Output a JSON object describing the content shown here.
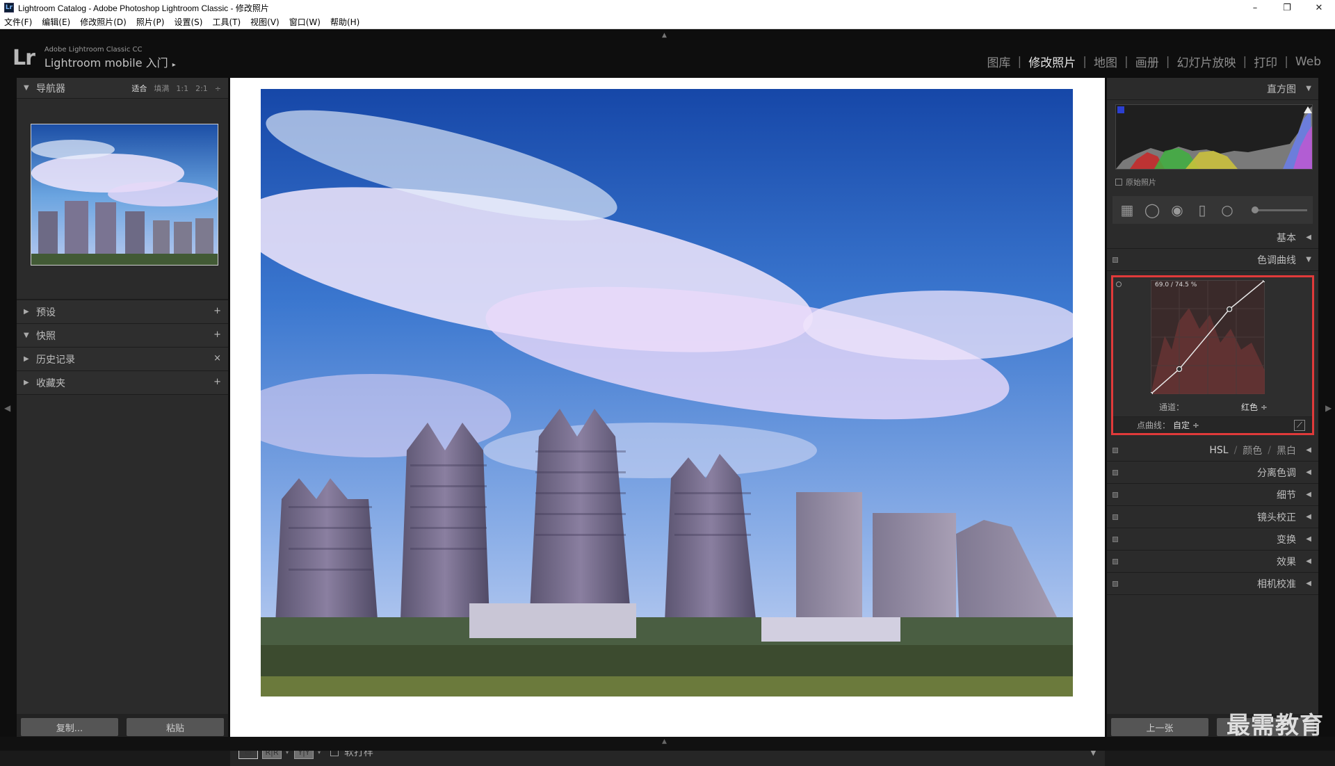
{
  "window": {
    "icon_text": "Lr",
    "title": "Lightroom Catalog - Adobe Photoshop Lightroom Classic - 修改照片",
    "minimize": "–",
    "maximize": "❐",
    "close": "✕"
  },
  "menu": [
    "文件(F)",
    "编辑(E)",
    "修改照片(D)",
    "照片(P)",
    "设置(S)",
    "工具(T)",
    "视图(V)",
    "窗口(W)",
    "帮助(H)"
  ],
  "identity": {
    "logo": "Lr",
    "product": "Adobe Lightroom Classic CC",
    "mobile": "Lightroom mobile 入门",
    "mobile_arrow": "▸"
  },
  "modules": [
    {
      "label": "图库",
      "active": false
    },
    {
      "label": "修改照片",
      "active": true
    },
    {
      "label": "地图",
      "active": false
    },
    {
      "label": "画册",
      "active": false
    },
    {
      "label": "幻灯片放映",
      "active": false
    },
    {
      "label": "打印",
      "active": false
    },
    {
      "label": "Web",
      "active": false
    }
  ],
  "left_panel": {
    "navigator": {
      "title": "导航器",
      "zoom_fit": "适合",
      "zoom_fill": "填满",
      "zoom_1_1": "1:1",
      "zoom_2_1": "2:1",
      "zoom_more": "÷"
    },
    "sections": [
      {
        "name": "presets",
        "title": "预设",
        "tri": "▶",
        "action": "+"
      },
      {
        "name": "snapshots",
        "title": "快照",
        "tri": "▼",
        "action": "+"
      },
      {
        "name": "history",
        "title": "历史记录",
        "tri": "▶",
        "action": "×"
      },
      {
        "name": "collections",
        "title": "收藏夹",
        "tri": "▶",
        "action": "+"
      }
    ],
    "copy_button": "复制...",
    "paste_button": "粘贴"
  },
  "toolbar": {
    "view_ry": "R|R",
    "view_yy": "Y|Y",
    "soft_proof": "软打样"
  },
  "right_panel": {
    "histogram": {
      "title": "直方图",
      "original_photo": "原始照片"
    },
    "basic": "基本",
    "tone_curve": {
      "title": "色调曲线",
      "readout": "69.0 / 74.5 %",
      "channel_label": "通道：",
      "channel_value": "红色 ÷",
      "point_curve_label": "点曲线：",
      "point_curve_value": "自定 ÷",
      "curve_points": [
        [
          0,
          0
        ],
        [
          25,
          22
        ],
        [
          69,
          74.5
        ],
        [
          100,
          100
        ]
      ]
    },
    "hsl": {
      "hsl": "HSL",
      "color": "颜色",
      "bw": "黑白",
      "sep": "/"
    },
    "sections": [
      {
        "name": "split-toning",
        "title": "分离色调"
      },
      {
        "name": "detail",
        "title": "细节"
      },
      {
        "name": "lens-corrections",
        "title": "镜头校正"
      },
      {
        "name": "transform",
        "title": "变换"
      },
      {
        "name": "effects",
        "title": "效果"
      },
      {
        "name": "camera-calibration",
        "title": "相机校准"
      }
    ],
    "previous_button": "上一张"
  },
  "watermark": "最需教育",
  "colors": {
    "accent_red": "#e03a3a",
    "panel_bg": "#2b2b2b",
    "canvas_bg": "#ffffff"
  }
}
